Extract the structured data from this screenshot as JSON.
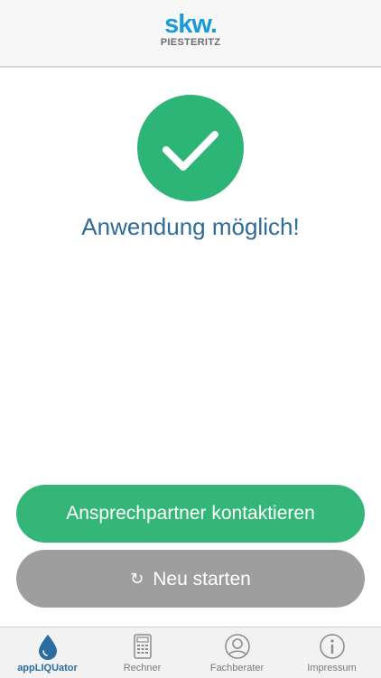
{
  "header": {
    "logo_main": "skw.",
    "logo_sub": "PIESTERITZ"
  },
  "result": {
    "icon": "checkmark-icon",
    "status": "Anwendung möglich!"
  },
  "buttons": {
    "contact": "Ansprechpartner kontaktieren",
    "restart_icon": "↻",
    "restart": "Neu starten"
  },
  "tabbar": {
    "items": [
      {
        "label": "appLIQUator",
        "icon": "droplet-icon",
        "active": true
      },
      {
        "label": "Rechner",
        "icon": "calculator-icon",
        "active": false
      },
      {
        "label": "Fachberater",
        "icon": "person-icon",
        "active": false
      },
      {
        "label": "Impressum",
        "icon": "info-icon",
        "active": false
      }
    ]
  },
  "colors": {
    "accent_green": "#2db577",
    "status_blue": "#2f6b98",
    "brand_blue": "#1a9ad6",
    "restart_gray": "#9e9e9e"
  }
}
